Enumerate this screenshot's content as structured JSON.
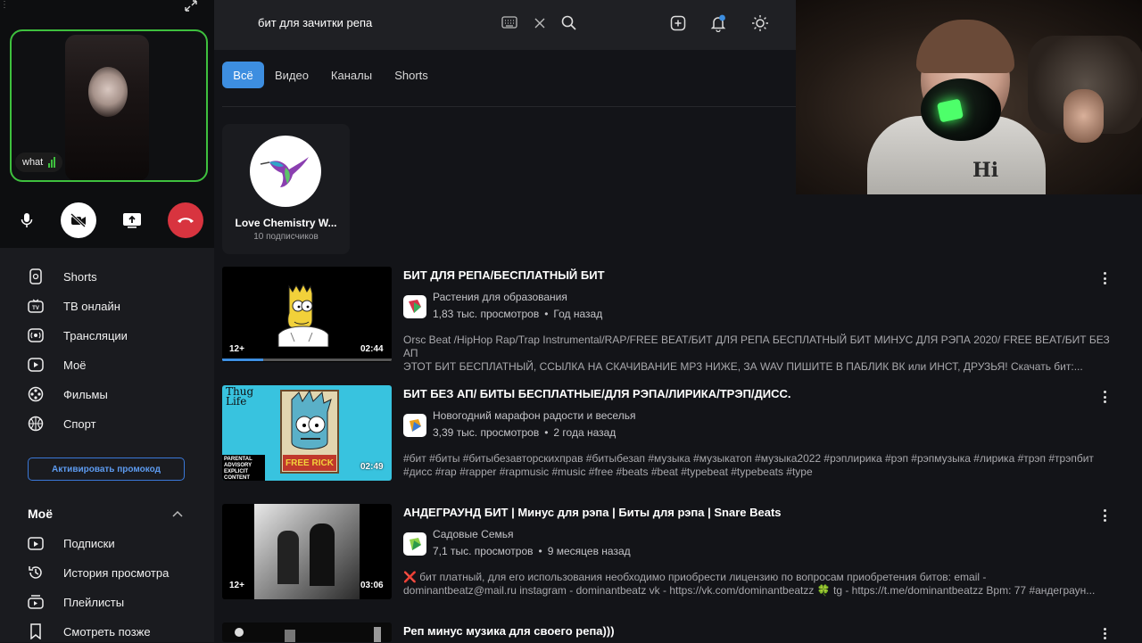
{
  "call": {
    "participant_name": "what",
    "controls": [
      "microphone",
      "camera-off",
      "screen-share",
      "end-call"
    ]
  },
  "sidebar": {
    "items": [
      {
        "label": "Shorts",
        "icon": "shorts-icon"
      },
      {
        "label": "ТВ онлайн",
        "icon": "tv-icon"
      },
      {
        "label": "Трансляции",
        "icon": "broadcast-icon"
      },
      {
        "label": "Моё",
        "icon": "my-icon"
      },
      {
        "label": "Фильмы",
        "icon": "film-icon"
      },
      {
        "label": "Спорт",
        "icon": "sport-icon"
      }
    ],
    "promo_label": "Активировать промокод",
    "section_title": "Моё",
    "section_items": [
      {
        "label": "Подписки",
        "icon": "subscriptions-icon"
      },
      {
        "label": "История просмотра",
        "icon": "history-icon"
      },
      {
        "label": "Плейлисты",
        "icon": "playlist-icon"
      },
      {
        "label": "Смотреть позже",
        "icon": "bookmark-icon"
      }
    ]
  },
  "search": {
    "query": "бит для зачитки репа"
  },
  "tabs": [
    {
      "label": "Всё",
      "active": true
    },
    {
      "label": "Видео",
      "active": false
    },
    {
      "label": "Каналы",
      "active": false
    },
    {
      "label": "Shorts",
      "active": false
    }
  ],
  "channel": {
    "name": "Love Chemistry W...",
    "subscribers": "10 подписчиков"
  },
  "videos": [
    {
      "title": "БИТ ДЛЯ РЕПА/БЕСПЛАТНЫЙ БИТ",
      "channel": "Растения для образования",
      "views": "1,83 тыс. просмотров",
      "age": "Год назад",
      "duration": "02:44",
      "rating": "12+",
      "watched_fraction": 0.24,
      "desc1": "Orsc Beat /HipHop Rap/Trap Instrumental/RAP/FREE BEAT/БИТ ДЛЯ РЕПА БЕСПЛАТНЫЙ БИТ МИНУС ДЛЯ РЭПА 2020/ FREE BEAT/БИТ БЕЗ АП",
      "desc2": "ЭТОТ БИТ БЕСПЛАТНЫЙ, ССЫЛКА НА СКАЧИВАНИЕ MP3 НИЖЕ, ЗА WAV ПИШИТЕ В ПАБЛИК ВК или ИНСТ, ДРУЗЬЯ! Скачать бит:..."
    },
    {
      "title": "БИТ БЕЗ АП/ БИТЫ БЕСПЛАТНЫЕ/ДЛЯ РЭПА/ЛИРИКА/ТРЭП/ДИСС.",
      "channel": "Новогодний марафон радости и веселья",
      "views": "3,39 тыс. просмотров",
      "age": "2 года назад",
      "duration": "02:49",
      "thumb_text_1": "Thug Life",
      "thumb_text_2": "FREE RICK",
      "thumb_text_3": "PARENTAL ADVISORY EXPLICIT CONTENT",
      "desc1": "#бит #биты #битыбезавторскихправ #битыбезап #музыка #музыкатоп #музыка2022 #рэплирика #рэп #рэпмузыка #лирика #трэп #трэпбит",
      "desc2": "#дисс #rap #rapper #rapmusic #music #free #beats #beat #typebeat #typebeats #type"
    },
    {
      "title": "АНДЕГРАУНД БИТ | Минус для рэпа | Биты для рэпа | Snare Beats",
      "channel": "Садовые Семья",
      "views": "7,1 тыс. просмотров",
      "age": "9 месяцев назад",
      "duration": "03:06",
      "rating": "12+",
      "desc1": "❌ бит платный, для его использования необходимо приобрести лицензию по вопросам приобретения битов: email -",
      "desc2": "dominantbeatz@mail.ru instagram - dominantbeatz vk - https://vk.com/dominantbeatzz 🍀 tg - https://t.me/dominantbeatzz Bpm: 77 #андеграун..."
    },
    {
      "title": "Реп минус музика для своего репа)))"
    }
  ],
  "colors": {
    "accent": "#3d8ee0",
    "call_border": "#3ec03e",
    "end_call": "#d8343f",
    "background": "#131418"
  }
}
